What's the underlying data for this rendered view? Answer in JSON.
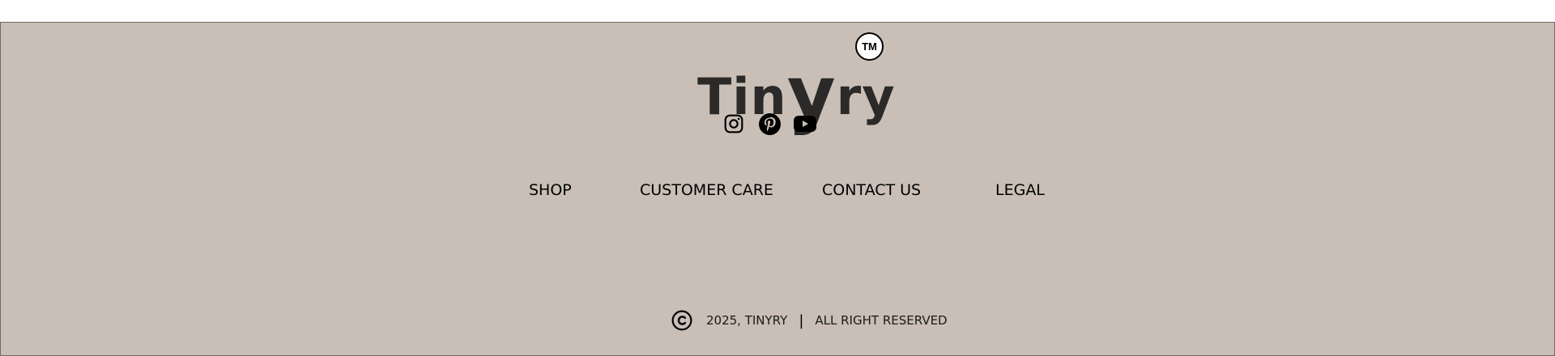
{
  "brand": {
    "logo_prefix": "Tin",
    "logo_big_letter": "y",
    "logo_suffix": "ry",
    "trademark": "TM",
    "background_color": "#c9bfb6",
    "text_color": "#2b2a29"
  },
  "social": [
    {
      "name": "instagram",
      "icon": "instagram-icon"
    },
    {
      "name": "pinterest",
      "icon": "pinterest-icon"
    },
    {
      "name": "youtube",
      "icon": "youtube-icon"
    }
  ],
  "nav": {
    "shop": "SHOP",
    "customer_care": "CUSTOMER CARE",
    "contact_us": "CONTACT US",
    "legal": "LEGAL"
  },
  "copyright": {
    "icon": "copyright-icon",
    "owner": "2025, TINYRY",
    "separator": "|",
    "rights": "ALL RIGHT RESERVED"
  }
}
